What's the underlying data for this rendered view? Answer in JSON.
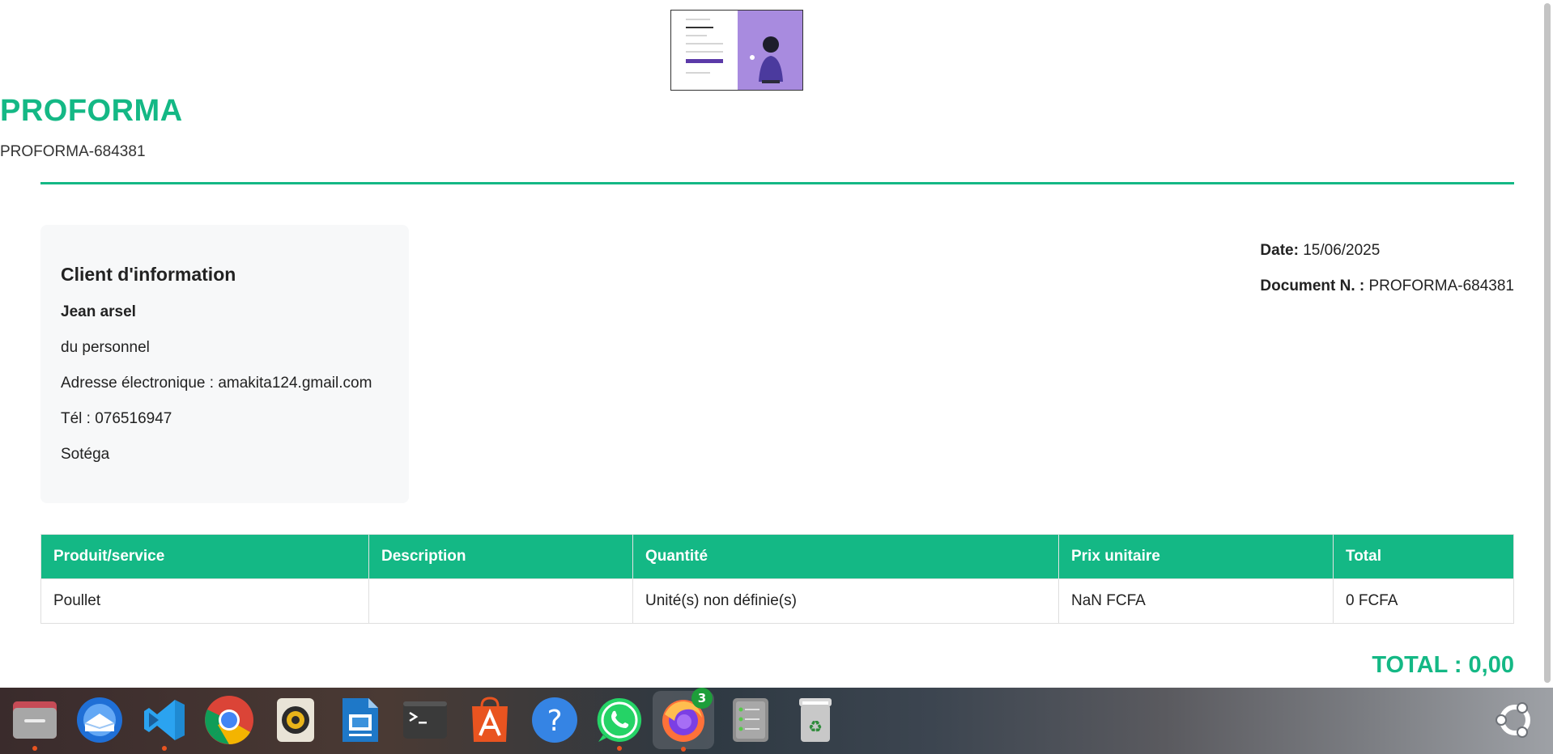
{
  "document": {
    "title": "PROFORMA",
    "reference": "PROFORMA-684381"
  },
  "client": {
    "heading": "Client d'information",
    "name": "Jean arsel",
    "role": "du personnel",
    "email": "Adresse électronique : amakita124.gmail.com",
    "phone": "Tél : 076516947",
    "company": "Sotéga"
  },
  "meta": {
    "date_label": "Date:",
    "date_value": "15/06/2025",
    "doc_label": "Document N. :",
    "doc_value": "PROFORMA-684381"
  },
  "table": {
    "headers": [
      "Produit/service",
      "Description",
      "Quantité",
      "Prix unitaire",
      "Total"
    ],
    "rows": [
      [
        "Poullet",
        "",
        "Unité(s) non définie(s)",
        "NaN FCFA",
        "0 FCFA"
      ]
    ]
  },
  "total": "TOTAL : 0,00",
  "dock": {
    "items": [
      {
        "name": "files-icon",
        "running": true
      },
      {
        "name": "thunderbird-icon",
        "running": false
      },
      {
        "name": "vscode-icon",
        "running": true
      },
      {
        "name": "chrome-icon",
        "running": false
      },
      {
        "name": "rhythmbox-icon",
        "running": false
      },
      {
        "name": "libreoffice-impress-icon",
        "running": false
      },
      {
        "name": "terminal-icon",
        "running": false
      },
      {
        "name": "app-center-icon",
        "running": false
      },
      {
        "name": "help-icon",
        "running": false
      },
      {
        "name": "whatsapp-icon",
        "running": true
      },
      {
        "name": "firefox-icon",
        "running": true,
        "badge": "3"
      },
      {
        "name": "archive-manager-icon",
        "running": false
      },
      {
        "name": "trash-icon",
        "running": false
      },
      {
        "name": "ubuntu-apps-icon",
        "running": false
      }
    ],
    "firefox_badge": "3"
  },
  "colors": {
    "accent": "#14b885",
    "dock_dot": "#e95420"
  }
}
